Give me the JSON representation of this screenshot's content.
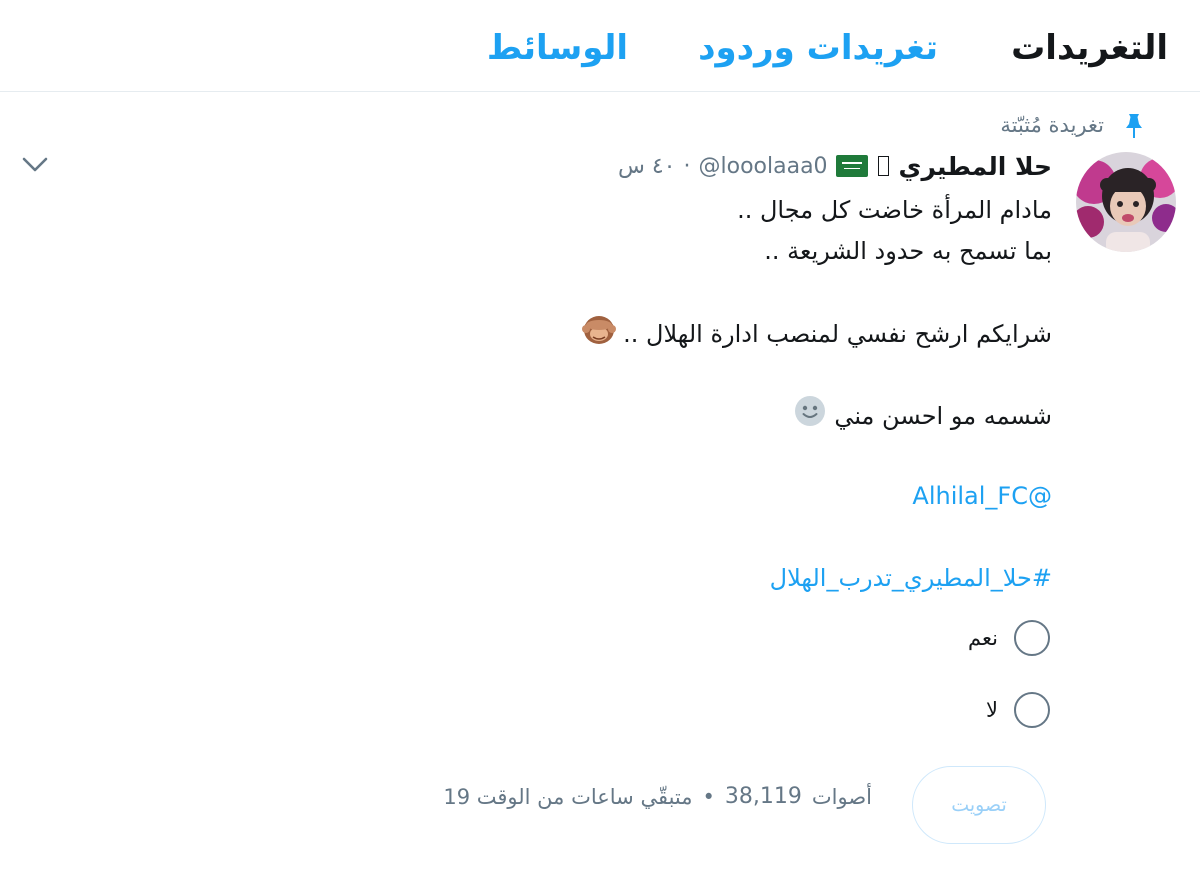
{
  "tabs": [
    {
      "label": "التغريدات",
      "active": true
    },
    {
      "label": "تغريدات وردود",
      "active": false
    },
    {
      "label": "الوسائط",
      "active": false
    }
  ],
  "pinned": {
    "label": "تغريدة مُثبّتة",
    "icon": "pin-icon"
  },
  "tweet": {
    "author_name": "حلا المطيري",
    "handle": "@looolaaa0",
    "separator": "·",
    "time": "٤٠ س",
    "lines": [
      "مادام المرأة خاضت كل مجال ..",
      "بما تسمح به حدود الشريعة ..",
      "شرايكم ارشح نفسي لمنصب ادارة الهلال ..",
      "شسمه مو احسن مني",
      "@Alhilal_FC",
      "#حلا_المطيري_تدرب_الهلال"
    ],
    "emojis": [
      "see-no-evil-monkey-emoji",
      "slightly-smiling-face-emoji"
    ]
  },
  "poll": {
    "options": [
      "نعم",
      "لا"
    ],
    "vote_label": "تصويت",
    "votes_count": "38,119",
    "votes_label": "أصوات",
    "bullet": "•",
    "time_left": "متبقّي ساعات من الوقت 19"
  },
  "colors": {
    "accent": "#1da1f2",
    "muted": "#657786",
    "text": "#14171a",
    "border": "#e6ecf0"
  }
}
